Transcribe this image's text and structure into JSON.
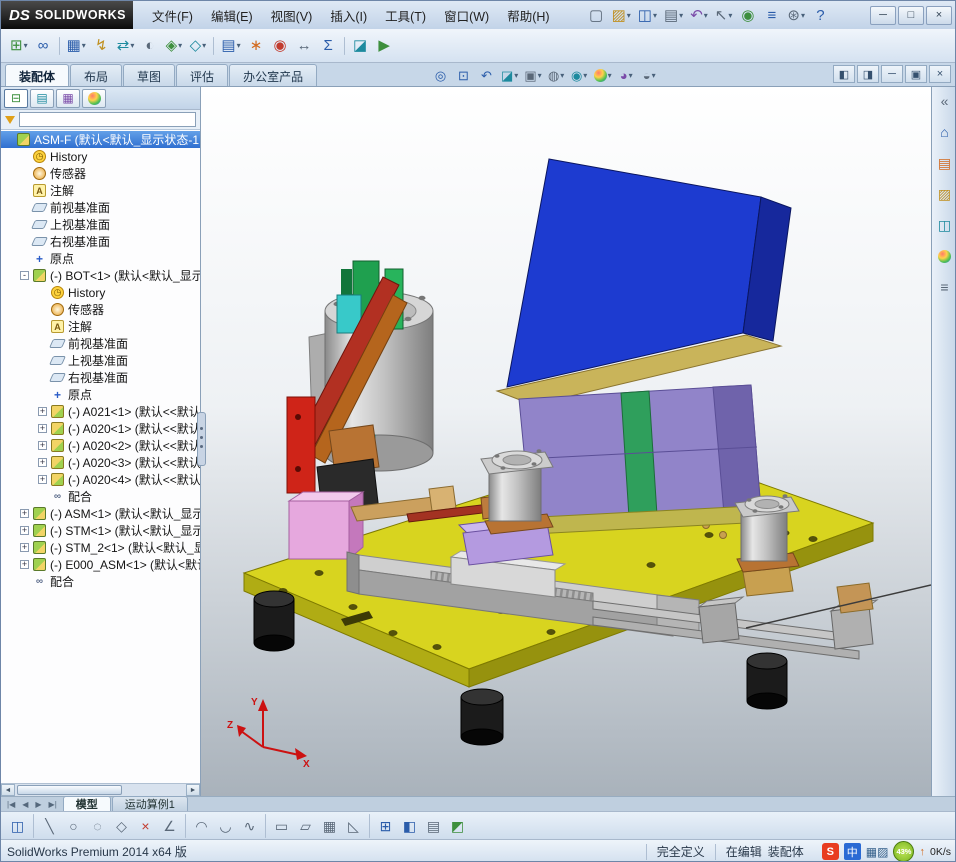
{
  "titlebar": {
    "logo_mark": "DS",
    "logo_text": "SOLIDWORKS",
    "menus": [
      "文件(F)",
      "编辑(E)",
      "视图(V)",
      "插入(I)",
      "工具(T)",
      "窗口(W)",
      "帮助(H)"
    ],
    "quick_icons": [
      {
        "name": "new-document-icon",
        "glyph": "▢",
        "color": "gray"
      },
      {
        "name": "open-icon",
        "glyph": "▨",
        "color": "yellow",
        "caret": "▾"
      },
      {
        "name": "save-icon",
        "glyph": "◫",
        "color": "blue",
        "caret": "▾"
      },
      {
        "name": "print-icon",
        "glyph": "▤",
        "color": "gray",
        "caret": "▾"
      },
      {
        "name": "undo-icon",
        "glyph": "↶",
        "color": "purple",
        "caret": "▾"
      },
      {
        "name": "select-icon",
        "glyph": "↖",
        "color": "gray",
        "caret": "▾"
      },
      {
        "name": "rebuild-icon",
        "glyph": "◉",
        "color": "green"
      },
      {
        "name": "file-properties-icon",
        "glyph": "≡",
        "color": "blue"
      },
      {
        "name": "options-icon",
        "glyph": "⊛",
        "color": "gray",
        "caret": "▾"
      },
      {
        "name": "help-icon",
        "glyph": "?",
        "color": "blue"
      }
    ],
    "window_buttons": [
      {
        "name": "minimize-button",
        "glyph": "─"
      },
      {
        "name": "maximize-button",
        "glyph": "□"
      },
      {
        "name": "close-button",
        "glyph": "×"
      }
    ]
  },
  "main_toolbar": [
    {
      "name": "insert-components-icon",
      "glyph": "⊞",
      "color": "green",
      "caret": "▾"
    },
    {
      "name": "mate-icon",
      "glyph": "∞",
      "color": "blue"
    },
    {
      "name": "separator"
    },
    {
      "name": "linear-pattern-icon",
      "glyph": "▦",
      "color": "blue",
      "caret": "▾"
    },
    {
      "name": "smart-fasteners-icon",
      "glyph": "↯",
      "color": "yellow"
    },
    {
      "name": "move-component-icon",
      "glyph": "⇄",
      "color": "teal",
      "caret": "▾"
    },
    {
      "name": "show-hidden-icon",
      "glyph": "◐",
      "color": "gray"
    },
    {
      "name": "assembly-features-icon",
      "glyph": "◈",
      "color": "green",
      "caret": "▾"
    },
    {
      "name": "reference-geometry-icon",
      "glyph": "◇",
      "color": "teal",
      "caret": "▾"
    },
    {
      "name": "separator"
    },
    {
      "name": "bom-icon",
      "glyph": "▤",
      "color": "blue",
      "caret": "▾"
    },
    {
      "name": "exploded-view-icon",
      "glyph": "∗",
      "color": "orange"
    },
    {
      "name": "interference-detection-icon",
      "glyph": "◉",
      "color": "red"
    },
    {
      "name": "measure-icon",
      "glyph": "↔",
      "color": "gray"
    },
    {
      "name": "mass-properties-icon",
      "glyph": "Σ",
      "color": "blue"
    },
    {
      "name": "separator"
    },
    {
      "name": "section-view-icon",
      "glyph": "◪",
      "color": "teal"
    },
    {
      "name": "motion-study-icon",
      "glyph": "▶",
      "color": "green"
    }
  ],
  "command_tabs": [
    {
      "label": "装配体",
      "active": true
    },
    {
      "label": "布局"
    },
    {
      "label": "草图"
    },
    {
      "label": "评估"
    },
    {
      "label": "办公室产品"
    }
  ],
  "headsup_icons": [
    {
      "name": "zoom-fit-icon",
      "glyph": "◎",
      "color": "blue"
    },
    {
      "name": "zoom-area-icon",
      "glyph": "⊡",
      "color": "blue"
    },
    {
      "name": "previous-view-icon",
      "glyph": "↶",
      "color": "blue"
    },
    {
      "name": "section-view-icon",
      "glyph": "◪",
      "color": "teal",
      "caret": "▾"
    },
    {
      "name": "view-orientation-icon",
      "glyph": "▣",
      "color": "gray",
      "caret": "▾"
    },
    {
      "name": "display-style-icon",
      "glyph": "◍",
      "color": "gray",
      "caret": "▾"
    },
    {
      "name": "hide-show-items-icon",
      "glyph": "◉",
      "color": "teal",
      "caret": "▾"
    },
    {
      "name": "edit-appearance-icon",
      "glyph": "●",
      "color": "rainbow",
      "caret": "▾"
    },
    {
      "name": "apply-scene-icon",
      "glyph": "◕",
      "color": "purple",
      "caret": "▾"
    },
    {
      "name": "view-settings-icon",
      "glyph": "◒",
      "color": "gray",
      "caret": "▾"
    }
  ],
  "doc_window_buttons": [
    {
      "name": "doc-pane-left-icon",
      "glyph": "◧"
    },
    {
      "name": "doc-pane-right-icon",
      "glyph": "◨"
    },
    {
      "name": "doc-minimize-icon",
      "glyph": "─"
    },
    {
      "name": "doc-restore-icon",
      "glyph": "▣"
    },
    {
      "name": "doc-close-icon",
      "glyph": "×"
    }
  ],
  "feature_panel": {
    "manager_tabs": [
      {
        "name": "featuremanager-tab-icon",
        "glyph": "⊟",
        "color": "green",
        "active": true
      },
      {
        "name": "propertymanager-tab-icon",
        "glyph": "▤",
        "color": "teal"
      },
      {
        "name": "configurationmanager-tab-icon",
        "glyph": "▦",
        "color": "purple"
      },
      {
        "name": "displaymanager-tab-icon",
        "glyph": "●",
        "color": "rainbow"
      }
    ],
    "overflow_glyph": "»",
    "filter_value": "",
    "scroll_left": "◄",
    "scroll_right": "►",
    "tree": [
      {
        "label": "ASM-F (默认<默认_显示状态-1",
        "icon": "asm",
        "level": 0,
        "state": "selected"
      },
      {
        "label": "History",
        "icon": "history",
        "level": 1
      },
      {
        "label": "传感器",
        "icon": "sensor",
        "level": 1
      },
      {
        "label": "注解",
        "icon": "note",
        "level": 1
      },
      {
        "label": "前视基准面",
        "icon": "plane",
        "level": 1
      },
      {
        "label": "上视基准面",
        "icon": "plane",
        "level": 1
      },
      {
        "label": "右视基准面",
        "icon": "plane",
        "level": 1
      },
      {
        "label": "原点",
        "icon": "origin",
        "level": 1
      },
      {
        "label": "(-) BOT<1> (默认<默认_显示",
        "icon": "asm",
        "level": 1,
        "expander": "-"
      },
      {
        "label": "History",
        "icon": "history",
        "level": 2
      },
      {
        "label": "传感器",
        "icon": "sensor",
        "level": 2
      },
      {
        "label": "注解",
        "icon": "note",
        "level": 2
      },
      {
        "label": "前视基准面",
        "icon": "plane",
        "level": 2
      },
      {
        "label": "上视基准面",
        "icon": "plane",
        "level": 2
      },
      {
        "label": "右视基准面",
        "icon": "plane",
        "level": 2
      },
      {
        "label": "原点",
        "icon": "origin",
        "level": 2
      },
      {
        "label": "(-) A021<1> (默认<<默认",
        "icon": "part",
        "level": 2,
        "expander": "+"
      },
      {
        "label": "(-) A020<1> (默认<<默认",
        "icon": "part",
        "level": 2,
        "expander": "+"
      },
      {
        "label": "(-) A020<2> (默认<<默认",
        "icon": "part",
        "level": 2,
        "expander": "+"
      },
      {
        "label": "(-) A020<3> (默认<<默认",
        "icon": "part",
        "level": 2,
        "expander": "+"
      },
      {
        "label": "(-) A020<4> (默认<<默认",
        "icon": "part",
        "level": 2,
        "expander": "+"
      },
      {
        "label": "配合",
        "icon": "mate",
        "level": 2
      },
      {
        "label": "(-) ASM<1> (默认<默认_显示",
        "icon": "asm",
        "level": 1,
        "expander": "+"
      },
      {
        "label": "(-) STM<1> (默认<默认_显示",
        "icon": "asm",
        "level": 1,
        "expander": "+"
      },
      {
        "label": "(-) STM_2<1> (默认<默认_显",
        "icon": "asm",
        "level": 1,
        "expander": "+"
      },
      {
        "label": "(-) E000_ASM<1> (默认<默认",
        "icon": "asm",
        "level": 1,
        "expander": "+"
      },
      {
        "label": "配合",
        "icon": "mate",
        "level": 1
      }
    ]
  },
  "taskpane_icons": [
    {
      "name": "collapse-taskpane-icon",
      "glyph": "«",
      "color": "gray"
    },
    {
      "name": "sw-resources-icon",
      "glyph": "⌂",
      "color": "blue"
    },
    {
      "name": "design-library-icon",
      "glyph": "▤",
      "color": "orange"
    },
    {
      "name": "file-explorer-icon",
      "glyph": "▨",
      "color": "yellow"
    },
    {
      "name": "view-palette-icon",
      "glyph": "◫",
      "color": "teal"
    },
    {
      "name": "appearances-icon",
      "glyph": "●",
      "color": "rainbow"
    },
    {
      "name": "custom-properties-icon",
      "glyph": "≡",
      "color": "gray"
    }
  ],
  "viewport": {
    "triad": {
      "up": "Y",
      "right": "X",
      "out": "Z"
    }
  },
  "nav": {
    "arrows": [
      {
        "name": "nav-first-button",
        "glyph": "|◀"
      },
      {
        "name": "nav-prev-button",
        "glyph": "◀"
      },
      {
        "name": "nav-next-button",
        "glyph": "▶"
      },
      {
        "name": "nav-last-button",
        "glyph": "▶|"
      }
    ]
  },
  "bottom_tabs": [
    {
      "label": "模型",
      "active": true
    },
    {
      "label": "运动算例1"
    }
  ],
  "sketch_toolbar": [
    {
      "name": "save-icon",
      "glyph": "◫",
      "color": "blue"
    },
    {
      "name": "separator"
    },
    {
      "name": "line-icon",
      "glyph": "╲",
      "color": "gray"
    },
    {
      "name": "circle-icon",
      "glyph": "○",
      "color": "gray"
    },
    {
      "name": "ellipse-icon",
      "glyph": "◌",
      "color": "gray"
    },
    {
      "name": "polygon-icon",
      "glyph": "◇",
      "color": "gray"
    },
    {
      "name": "trim-icon",
      "glyph": "×",
      "color": "red"
    },
    {
      "name": "chamfer-icon",
      "glyph": "∠",
      "color": "gray"
    },
    {
      "name": "separator"
    },
    {
      "name": "arc-icon",
      "glyph": "◠",
      "color": "gray"
    },
    {
      "name": "tangent-arc-icon",
      "glyph": "◡",
      "color": "gray"
    },
    {
      "name": "spline-icon",
      "glyph": "∿",
      "color": "gray"
    },
    {
      "name": "separator"
    },
    {
      "name": "rectangle-icon",
      "glyph": "▭",
      "color": "gray"
    },
    {
      "name": "slot-icon",
      "glyph": "▱",
      "color": "gray"
    },
    {
      "name": "pattern-icon",
      "glyph": "▦",
      "color": "gray"
    },
    {
      "name": "angle-icon",
      "glyph": "◺",
      "color": "gray"
    },
    {
      "name": "separator"
    },
    {
      "name": "convert-entities-icon",
      "glyph": "⊞",
      "color": "blue"
    },
    {
      "name": "shaded-view-icon",
      "glyph": "◧",
      "color": "blue"
    },
    {
      "name": "grid-icon",
      "glyph": "▤",
      "color": "gray"
    },
    {
      "name": "iso-cube-icon",
      "glyph": "◩",
      "color": "green"
    }
  ],
  "statusbar": {
    "app_version": "SolidWorks Premium 2014 x64 版",
    "define_state": "完全定义",
    "edit_label": "在编辑",
    "edit_target": "装配体",
    "tray": {
      "sogou": "S",
      "ime": "中",
      "icons": [
        {
          "name": "tray-keyboard-icon",
          "glyph": "▦"
        },
        {
          "name": "tray-pen-icon",
          "glyph": "▨"
        }
      ],
      "battery": "43%",
      "net_up": "↑",
      "net": "0K/s"
    }
  }
}
